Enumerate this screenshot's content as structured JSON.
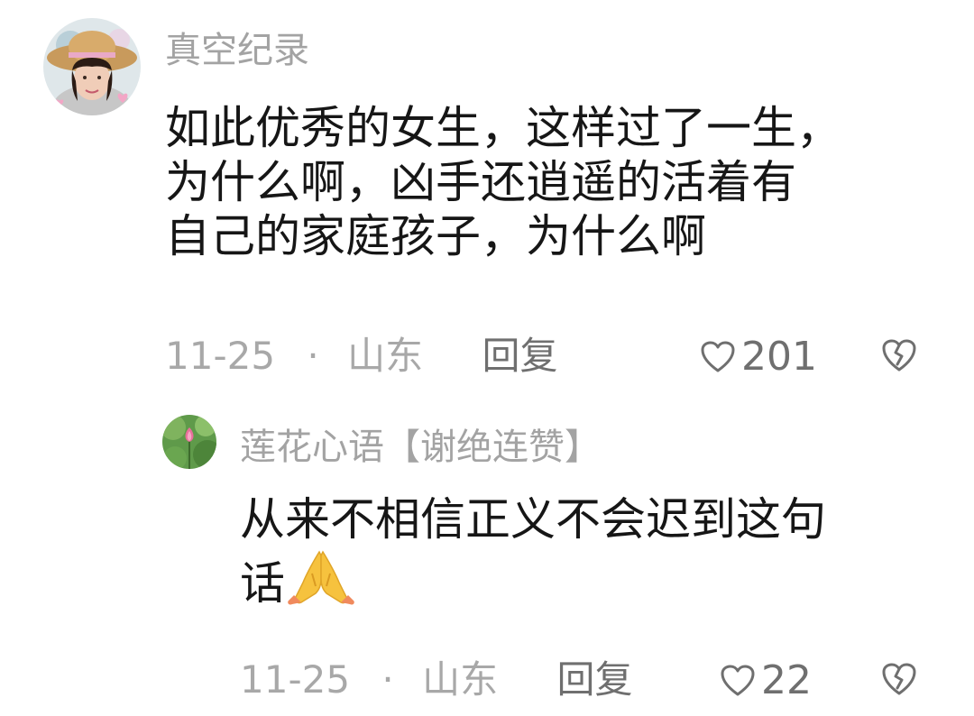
{
  "comments": [
    {
      "username": "真空纪录",
      "text_lines": [
        "如此优秀的女生，这样过了一生，",
        "为什么啊，凶手还逍遥的活着有",
        "自己的家庭孩子，为什么啊"
      ],
      "date": "11-25",
      "separator": "·",
      "location": "山东",
      "reply_label": "回复",
      "like_count": "201",
      "avatar_icon": "woman-straw-hat-avatar"
    },
    {
      "username": "莲花心语【谢绝连赞】",
      "text_lines": [
        "从来不相信正义不会迟到这句",
        "话"
      ],
      "emoji": "folded-hands-emoji",
      "date": "11-25",
      "separator": "·",
      "location": "山东",
      "reply_label": "回复",
      "like_count": "22",
      "avatar_icon": "lotus-flower-avatar"
    }
  ],
  "colors": {
    "text": "#161616",
    "username": "#a3a3a3",
    "meta": "#a8a8a8",
    "action": "#6f6f6f"
  }
}
